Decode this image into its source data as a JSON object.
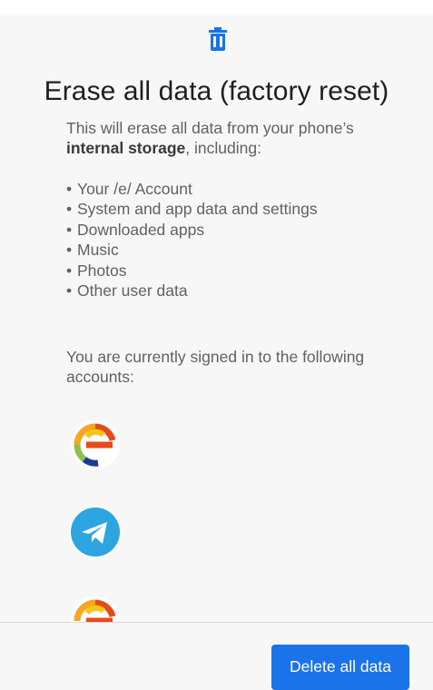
{
  "header": {
    "icon": "trash-icon",
    "accent": "#1a73e8"
  },
  "title": "Erase all data (factory reset)",
  "intro": {
    "text_before": "This will erase all data from your phone’s",
    "bold": "internal storage",
    "text_after": ", including:"
  },
  "items": [
    "Your /e/ Account",
    "System and app data and settings",
    "Downloaded apps",
    "Music",
    "Photos",
    "Other user data"
  ],
  "bullet": "•",
  "accounts_heading": "You are currently signed in to the following accounts:",
  "accounts": [
    {
      "icon": "e-account-icon"
    },
    {
      "icon": "telegram-icon"
    },
    {
      "icon": "e-account-icon"
    }
  ],
  "footer": {
    "delete_label": "Delete all data",
    "button_color": "#1a73e8"
  }
}
